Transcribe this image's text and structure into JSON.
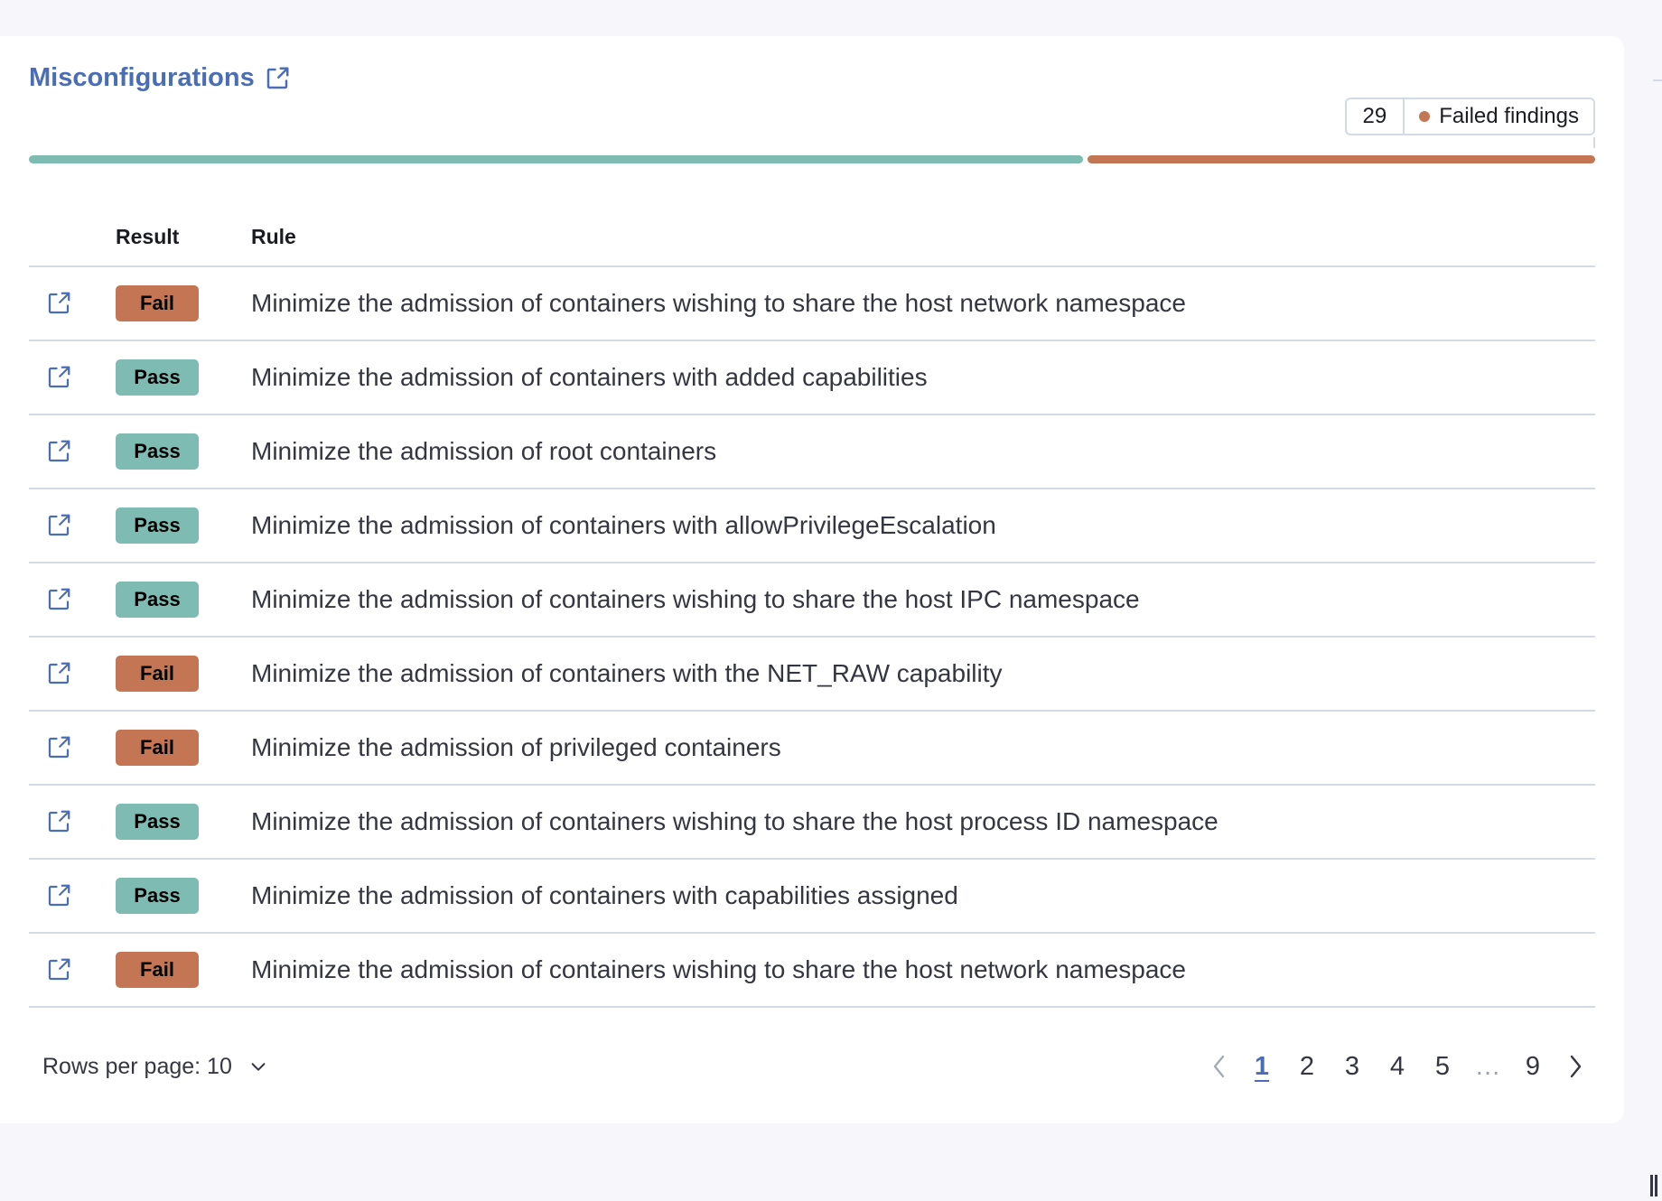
{
  "card": {
    "title": "Misconfigurations",
    "title_icon": "external-link-icon"
  },
  "summary": {
    "failed_count": "29",
    "failed_label": "Failed findings",
    "pass_fraction": 0.675,
    "fail_fraction": 0.325,
    "colors": {
      "pass": "#7dbbb3",
      "fail": "#c47554",
      "link": "#4a6db5"
    }
  },
  "table": {
    "columns": [
      "",
      "Result",
      "Rule"
    ],
    "rows": [
      {
        "result": "Fail",
        "rule": "Minimize the admission of containers wishing to share the host network namespace"
      },
      {
        "result": "Pass",
        "rule": "Minimize the admission of containers with added capabilities"
      },
      {
        "result": "Pass",
        "rule": "Minimize the admission of root containers"
      },
      {
        "result": "Pass",
        "rule": "Minimize the admission of containers with allowPrivilegeEscalation"
      },
      {
        "result": "Pass",
        "rule": "Minimize the admission of containers wishing to share the host IPC namespace"
      },
      {
        "result": "Fail",
        "rule": "Minimize the admission of containers with the NET_RAW capability"
      },
      {
        "result": "Fail",
        "rule": "Minimize the admission of privileged containers"
      },
      {
        "result": "Pass",
        "rule": "Minimize the admission of containers wishing to share the host process ID namespace"
      },
      {
        "result": "Pass",
        "rule": "Minimize the admission of containers with capabilities assigned"
      },
      {
        "result": "Fail",
        "rule": "Minimize the admission of containers wishing to share the host network namespace"
      }
    ]
  },
  "pagination": {
    "rows_per_page_label": "Rows per page: 10",
    "pages": [
      "1",
      "2",
      "3",
      "4",
      "5",
      "…",
      "9"
    ],
    "current_page": "1"
  }
}
